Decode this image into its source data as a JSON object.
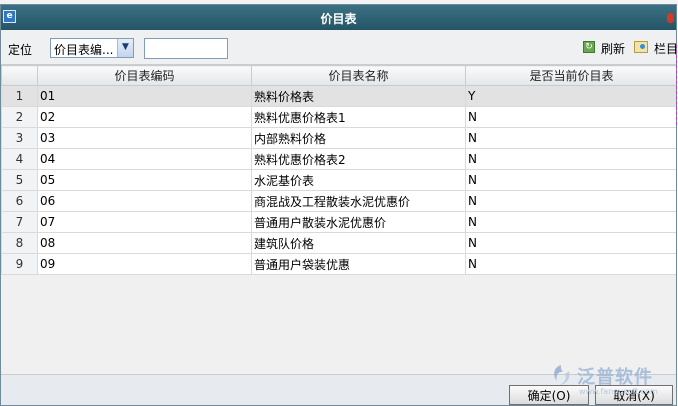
{
  "window": {
    "title": "价目表"
  },
  "toolbar": {
    "locate_label": "定位",
    "locate_select_value": "价目表编...",
    "search_value": "",
    "refresh_label": "刷新",
    "columns_label": "栏目"
  },
  "grid": {
    "columns": [
      "价目表编码",
      "价目表名称",
      "是否当前价目表"
    ],
    "rows": [
      {
        "n": "1",
        "code": "01",
        "name": "熟料价格表",
        "current": "Y"
      },
      {
        "n": "2",
        "code": "02",
        "name": "熟料优惠价格表1",
        "current": "N"
      },
      {
        "n": "3",
        "code": "03",
        "name": "内部熟料价格",
        "current": "N"
      },
      {
        "n": "4",
        "code": "04",
        "name": "熟料优惠价格表2",
        "current": "N"
      },
      {
        "n": "5",
        "code": "05",
        "name": "水泥基价表",
        "current": "N"
      },
      {
        "n": "6",
        "code": "06",
        "name": "商混战及工程散装水泥优惠价",
        "current": "N"
      },
      {
        "n": "7",
        "code": "07",
        "name": "普通用户散装水泥优惠价",
        "current": "N"
      },
      {
        "n": "8",
        "code": "08",
        "name": "建筑队价格",
        "current": "N"
      },
      {
        "n": "9",
        "code": "09",
        "name": "普通用户袋装优惠",
        "current": "N"
      }
    ]
  },
  "footer": {
    "ok_label": "确定(O)",
    "cancel_label": "取消(X)"
  },
  "watermark": {
    "text": "泛普软件",
    "url": "www.fanpusoft.com"
  },
  "colors": {
    "titlebar": "#2f6374",
    "selected_row": "#e2e2e2"
  }
}
